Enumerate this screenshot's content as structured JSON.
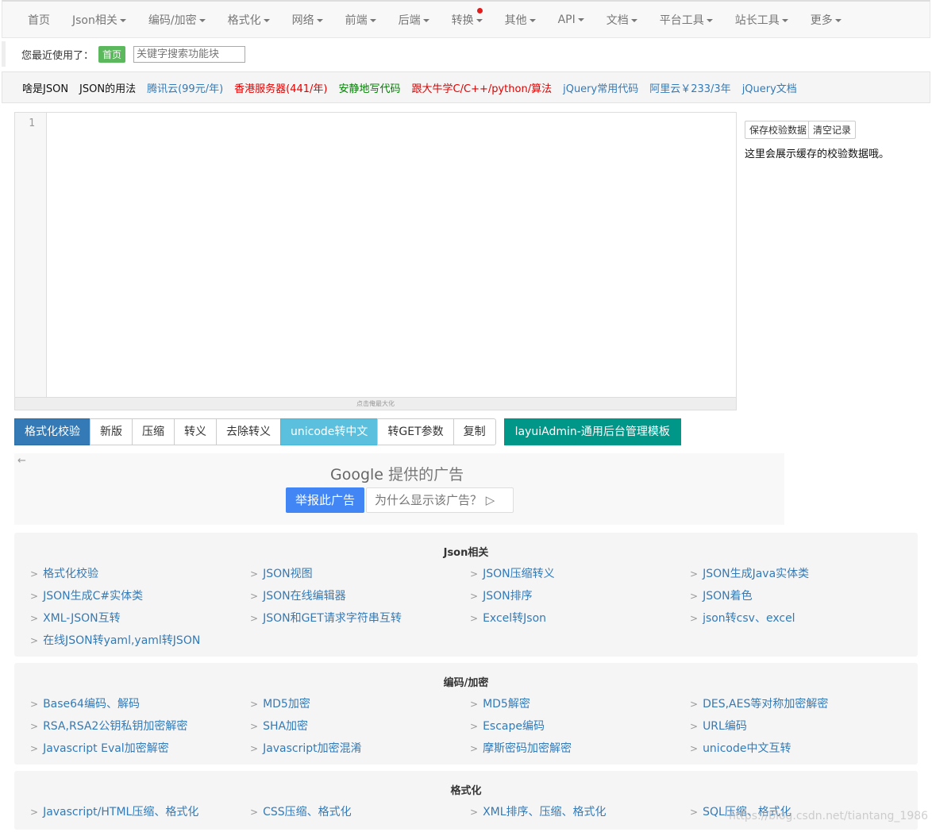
{
  "nav": {
    "items": [
      {
        "label": "首页",
        "dropdown": false
      },
      {
        "label": "Json相关",
        "dropdown": true
      },
      {
        "label": "编码/加密",
        "dropdown": true
      },
      {
        "label": "格式化",
        "dropdown": true
      },
      {
        "label": "网络",
        "dropdown": true
      },
      {
        "label": "前端",
        "dropdown": true
      },
      {
        "label": "后端",
        "dropdown": true
      },
      {
        "label": "转换",
        "dropdown": true
      },
      {
        "label": "其他",
        "dropdown": true
      },
      {
        "label": "API",
        "dropdown": true
      },
      {
        "label": "文档",
        "dropdown": true
      },
      {
        "label": "平台工具",
        "dropdown": true
      },
      {
        "label": "站长工具",
        "dropdown": true
      },
      {
        "label": "更多",
        "dropdown": true
      }
    ]
  },
  "recent": {
    "label": "您最近使用了：",
    "tag": "首页",
    "search_placeholder": "关键字搜索功能块"
  },
  "links": [
    {
      "text": "啥是JSON",
      "color": "#111111"
    },
    {
      "text": "JSON的用法",
      "color": "#111111"
    },
    {
      "text": "腾讯云(99元/年)",
      "color": "#337ab7"
    },
    {
      "text": "香港服务器(441/年)",
      "color": "#e00000"
    },
    {
      "text": "安静地写代码",
      "color": "#008000"
    },
    {
      "text": "跟大牛学C/C++/python/算法",
      "color": "#e00000"
    },
    {
      "text": "jQuery常用代码",
      "color": "#337ab7"
    },
    {
      "text": "阿里云￥233/3年",
      "color": "#337ab7"
    },
    {
      "text": "jQuery文档",
      "color": "#337ab7"
    }
  ],
  "editor": {
    "line_number": "1",
    "hint": "点击俺最大化"
  },
  "side": {
    "save_label": "保存校验数据",
    "clear_label": "清空记录",
    "note": "这里会展示缓存的校验数据哦。"
  },
  "toolbar": {
    "buttons": [
      "格式化校验",
      "新版",
      "压缩",
      "转义",
      "去除转义",
      "unicode转中文",
      "转GET参数",
      "复制"
    ],
    "promo": "layuiAdmin-通用后台管理模板"
  },
  "ad": {
    "google": "Google",
    "provided": "提供的广告",
    "report": "举报此广告",
    "why": "为什么显示该广告？"
  },
  "sections": [
    {
      "title": "Json相关",
      "items": [
        "格式化校验",
        "JSON视图",
        "JSON压缩转义",
        "JSON生成Java实体类",
        "JSON生成C#实体类",
        "JSON在线编辑器",
        "JSON排序",
        "JSON着色",
        "XML-JSON互转",
        "JSON和GET请求字符串互转",
        "Excel转Json",
        "json转csv、excel",
        "在线JSON转yaml,yaml转JSON"
      ]
    },
    {
      "title": "编码/加密",
      "items": [
        "Base64编码、解码",
        "MD5加密",
        "MD5解密",
        "DES,AES等对称加密解密",
        "RSA,RSA2公钥私钥加密解密",
        "SHA加密",
        "Escape编码",
        "URL编码",
        "Javascript Eval加密解密",
        "Javascript加密混淆",
        "摩斯密码加密解密",
        "unicode中文互转"
      ]
    },
    {
      "title": "格式化",
      "items": [
        "Javascript/HTML压缩、格式化",
        "CSS压缩、格式化",
        "XML排序、压缩、格式化",
        "SQL压缩、格式化"
      ]
    }
  ],
  "watermark": "https://blog.csdn.net/tiantang_1986"
}
